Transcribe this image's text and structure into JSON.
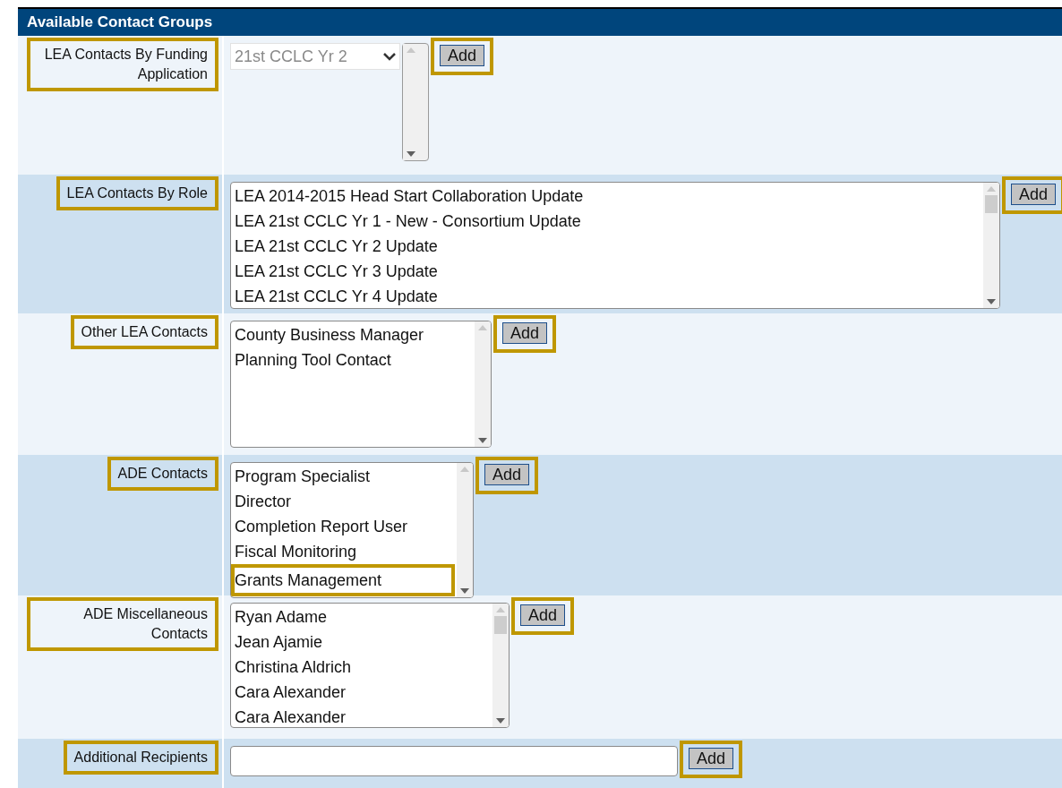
{
  "panel": {
    "title": "Available Contact Groups"
  },
  "rows": [
    {
      "label": "LEA Contacts By Funding Application",
      "highlighted": true,
      "control": {
        "kind": "select",
        "value": "21st CCLC Yr 2",
        "disabled": true
      },
      "button": {
        "label": "Add",
        "highlighted": true
      }
    },
    {
      "label": "LEA Contacts By Role",
      "highlighted": true,
      "control": {
        "kind": "listbox",
        "items": [
          {
            "text": "LEA 2014-2015 Head Start Collaboration Update",
            "highlighted": false
          },
          {
            "text": "LEA 21st CCLC Yr 1 - New - Consortium Update",
            "highlighted": false
          },
          {
            "text": "LEA 21st CCLC Yr 2 Update",
            "highlighted": false
          },
          {
            "text": "LEA 21st CCLC Yr 3 Update",
            "highlighted": false
          },
          {
            "text": "LEA 21st CCLC Yr 4 Update",
            "highlighted": false
          }
        ]
      },
      "button": {
        "label": "Add",
        "highlighted": true
      }
    },
    {
      "label": "Other LEA Contacts",
      "highlighted": true,
      "control": {
        "kind": "listbox",
        "items": [
          {
            "text": "County Business Manager",
            "highlighted": false
          },
          {
            "text": "Planning Tool Contact",
            "highlighted": false
          }
        ]
      },
      "button": {
        "label": "Add",
        "highlighted": true
      }
    },
    {
      "label": "ADE Contacts",
      "highlighted": true,
      "control": {
        "kind": "listbox",
        "items": [
          {
            "text": "Program Specialist",
            "highlighted": false
          },
          {
            "text": "Director",
            "highlighted": false
          },
          {
            "text": "Completion Report User",
            "highlighted": false
          },
          {
            "text": "Fiscal Monitoring",
            "highlighted": false
          },
          {
            "text": "Grants Management",
            "highlighted": true
          }
        ]
      },
      "button": {
        "label": "Add",
        "highlighted": true
      }
    },
    {
      "label": "ADE Miscellaneous Contacts",
      "highlighted": true,
      "control": {
        "kind": "listbox",
        "items": [
          {
            "text": "Ryan Adame",
            "highlighted": false
          },
          {
            "text": "Jean Ajamie",
            "highlighted": false
          },
          {
            "text": "Christina Aldrich",
            "highlighted": false
          },
          {
            "text": "Cara Alexander",
            "highlighted": false
          },
          {
            "text": "Cara Alexander",
            "highlighted": false
          }
        ]
      },
      "button": {
        "label": "Add",
        "highlighted": true
      }
    },
    {
      "label": "Additional Recipients",
      "highlighted": true,
      "control": {
        "kind": "text"
      },
      "button": {
        "label": "Add",
        "highlighted": true
      }
    }
  ]
}
